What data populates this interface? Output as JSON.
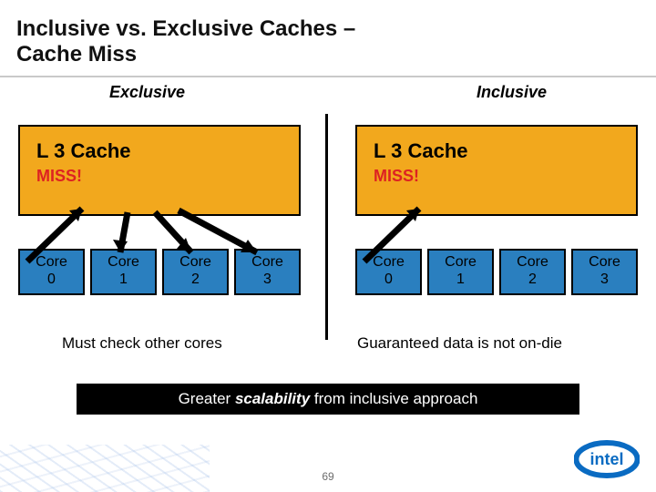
{
  "title_line1": "Inclusive vs. Exclusive Caches –",
  "title_line2": "Cache Miss",
  "columns": {
    "left": {
      "header": "Exclusive",
      "l3_label": "L 3 Cache",
      "miss": "MISS!",
      "cores": [
        "Core 0",
        "Core 1",
        "Core 2",
        "Core 3"
      ],
      "caption": "Must check other cores"
    },
    "right": {
      "header": "Inclusive",
      "l3_label": "L 3 Cache",
      "miss": "MISS!",
      "cores": [
        "Core 0",
        "Core 1",
        "Core 2",
        "Core 3"
      ],
      "caption": "Guaranteed data is not on-die"
    }
  },
  "banner_pre": "Greater ",
  "banner_em": "scalability",
  "banner_post": " from inclusive approach",
  "page_number": "69",
  "logo_label": "intel",
  "colors": {
    "l3_bg": "#f2a81d",
    "core_bg": "#2a7fbf",
    "miss": "#d22",
    "banner_bg": "#000"
  }
}
